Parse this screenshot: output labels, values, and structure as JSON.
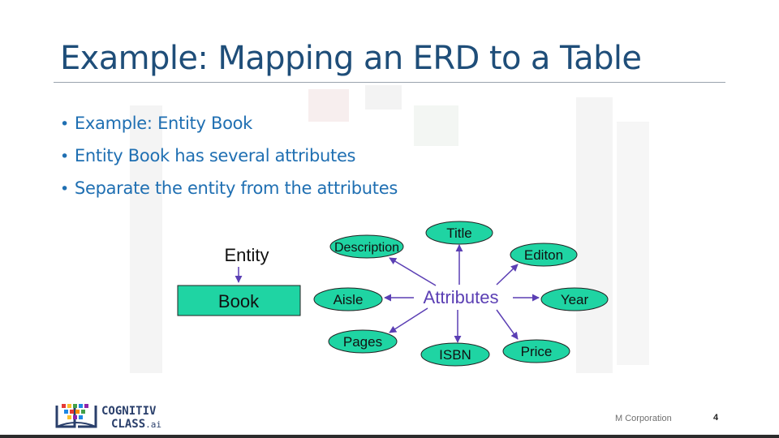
{
  "slide": {
    "title": "Example: Mapping an ERD to a Table",
    "bullets": [
      "Example: Entity Book",
      "Entity Book has several attributes",
      "Separate the entity from the attributes"
    ],
    "company": "M Corporation",
    "page_number": "4"
  },
  "logo": {
    "line1": "COGNITIV",
    "line2": "CLASS",
    "suffix": ".ai"
  },
  "diagram": {
    "entity_label": "Entity",
    "entity_name": "Book",
    "hub_label": "Attributes",
    "attributes": {
      "description": "Description",
      "title": "Title",
      "edition": "Editon",
      "aisle": "Aisle",
      "year": "Year",
      "pages": "Pages",
      "isbn": "ISBN",
      "price": "Price"
    },
    "colors": {
      "node_fill": "#1fd4a3",
      "arrow": "#5b3fb4",
      "text": "#111111"
    }
  }
}
